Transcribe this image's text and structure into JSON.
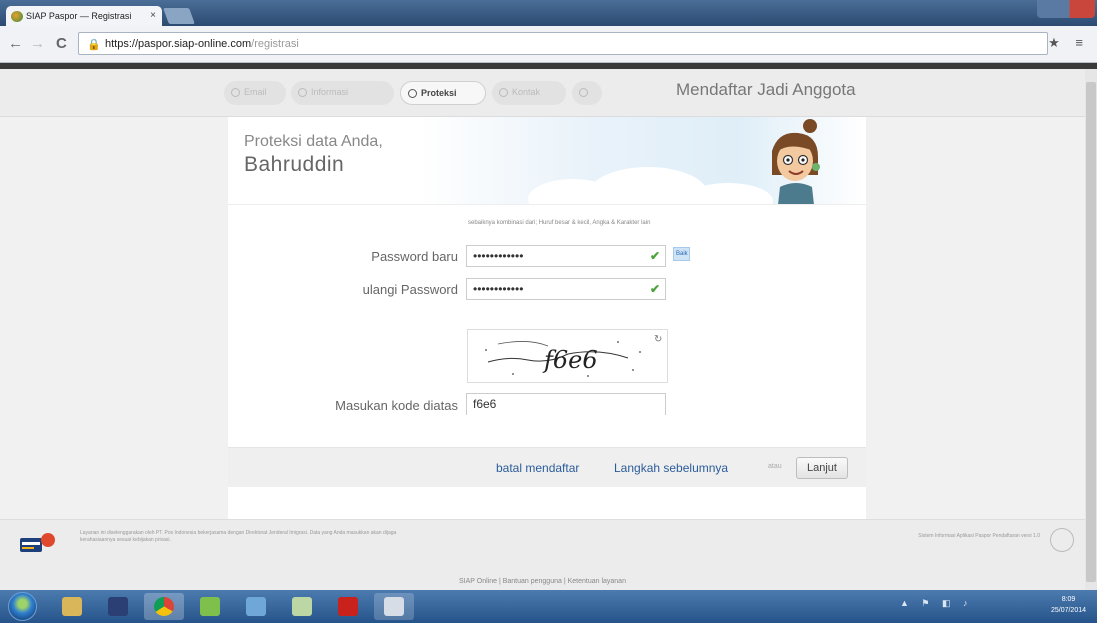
{
  "browser": {
    "tab_title": "SIAP Paspor — Registrasi",
    "tab_close": "×",
    "url_host": "https://paspor.siap-online.com",
    "url_path": "/registrasi",
    "back_icon": "←",
    "forward_icon": "→",
    "reload_icon": "C",
    "right_icons": "★ ≡"
  },
  "steps": [
    {
      "label": "Email"
    },
    {
      "label": "Informasi"
    },
    {
      "label": "Proteksi"
    },
    {
      "label": "Kontak"
    },
    {
      "label": ""
    }
  ],
  "page_title": "Mendaftar Jadi Anggota",
  "heading": {
    "line1": "Proteksi data Anda,",
    "name": "Bahruddin"
  },
  "form": {
    "hint": "sebaiknya kombinasi dari; Huruf besar & kecil, Angka & Karakter lain",
    "password_label": "Password baru",
    "password_value": "••••••••••••",
    "strength_label": "Baik",
    "confirm_label": "ulangi Password",
    "confirm_value": "••••••••••••",
    "captcha_text": "f6e6",
    "captcha_refresh": "↻",
    "code_label": "Masukan kode diatas",
    "code_value": "f6e6",
    "check_mark": "✔"
  },
  "actions": {
    "cancel_label": "batal mendaftar",
    "previous_label": "Langkah sebelumnya",
    "separator": "atau",
    "next_label": "Lanjut"
  },
  "footer": {
    "left_text": "Layanan ini diselenggarakan oleh PT. Pos Indonesia bekerjasama dengan Direktorat Jenderal Imigrasi. Data yang Anda masukkan akan dijaga kerahasiaannya sesuai kebijakan privasi.",
    "right_text": "Sistem Informasi Aplikasi Paspor Pendaftaran versi 1.0",
    "links": "SIAP Online | Bantuan pengguna | Ketentuan layanan"
  },
  "taskbar": {
    "clock_time": "8:09",
    "clock_date": "25/07/2014",
    "tray_icons": "▲ ⚑ ◧ ♪"
  }
}
